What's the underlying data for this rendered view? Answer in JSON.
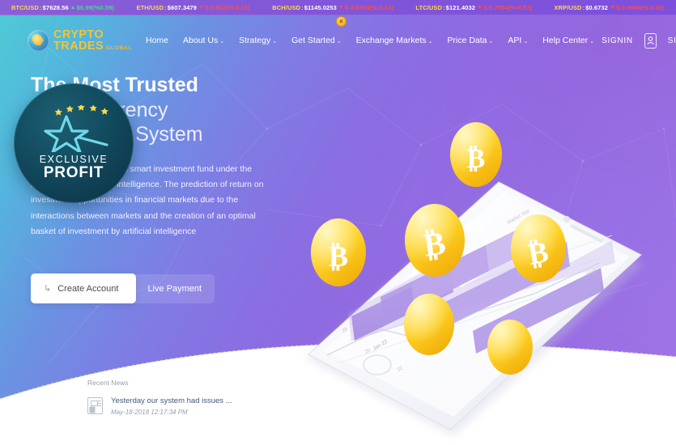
{
  "ticker": {
    "close_label": "×",
    "items": [
      {
        "pair": "BTC/USD",
        "sep": " : ",
        "price": "$7628.56",
        "dir": "up",
        "arrow": "▲",
        "change": "$6.99(%0.09)"
      },
      {
        "pair": "ETH/USD",
        "sep": " : ",
        "price": "$607.3479",
        "dir": "down",
        "arrow": "▼",
        "change": "$-0.962(%-0.16)"
      },
      {
        "pair": "BCH/USD",
        "sep": " : ",
        "price": "$1145.0253",
        "dir": "down",
        "arrow": "▼",
        "change": "$-4.6654(%-0.41)"
      },
      {
        "pair": "LTC/USD",
        "sep": " : ",
        "price": "$121.4032",
        "dir": "down",
        "arrow": "▼",
        "change": "$-0.7004(%-0.57)"
      },
      {
        "pair": "XRP/USD",
        "sep": " : ",
        "price": "$0.6732",
        "dir": "down",
        "arrow": "▼",
        "change": "$-0.0004(%-0.06)"
      }
    ]
  },
  "brand": {
    "line1": "CRYPTO",
    "line2": "TRADES",
    "sub": "GLOBAL",
    "logo_icon": "globe-icon"
  },
  "nav": {
    "items": [
      {
        "label": "Home",
        "caret": ""
      },
      {
        "label": "About Us",
        "caret": "⌄"
      },
      {
        "label": "Strategy",
        "caret": "⌄"
      },
      {
        "label": "Get Started",
        "caret": "⌄"
      },
      {
        "label": "Exchange Markets",
        "caret": "⌄"
      },
      {
        "label": "Price Data",
        "caret": "⌄"
      },
      {
        "label": "API",
        "caret": "⌄"
      },
      {
        "label": "Help Center",
        "caret": "⌄"
      }
    ]
  },
  "auth": {
    "signin": "SIGNIN",
    "signup": "SIGNUP",
    "avatar_icon": "user-icon"
  },
  "hero": {
    "title_line1": "The Most Trusted",
    "title_line2": "Cryptocurrency",
    "title_line3": "Investment System",
    "description": "Exclusive Profit is the first smart investment fund under the supervision of artificial intelligence. The prediction of return on investment opportunities in financial markets due to the interactions between markets and the creation of an optimal basket of investment by artificial intelligence",
    "btn_create": "Create Account",
    "btn_create_icon": "arrow-turn-icon",
    "btn_live": "Live Payment"
  },
  "badge": {
    "line1": "EXCLUSIVE",
    "line2": "PROFIT",
    "icon": "star-badge-icon"
  },
  "news": {
    "label": "Recent News",
    "icon": "newspaper-icon",
    "title": "Yesterday our system had issues ...",
    "date": "May-18-2018 12:17:34 PM"
  },
  "artwork": {
    "phone_icon": "smartphone-chart-icon",
    "coin_symbol": "₿",
    "coins": [
      {
        "name": "bitcoin-coin-top"
      },
      {
        "name": "bitcoin-coin-left"
      },
      {
        "name": "bitcoin-coin-center"
      },
      {
        "name": "bitcoin-coin-right"
      },
      {
        "name": "gold-coin-mid"
      },
      {
        "name": "gold-coin-low"
      }
    ]
  },
  "colors": {
    "ticker_pair": "#ffd84d",
    "up": "#38e08a",
    "down": "#ff4d4d",
    "brand_gold": "#f5c431",
    "hero_purple": "#9566de",
    "hero_teal": "#4fc9d6"
  }
}
